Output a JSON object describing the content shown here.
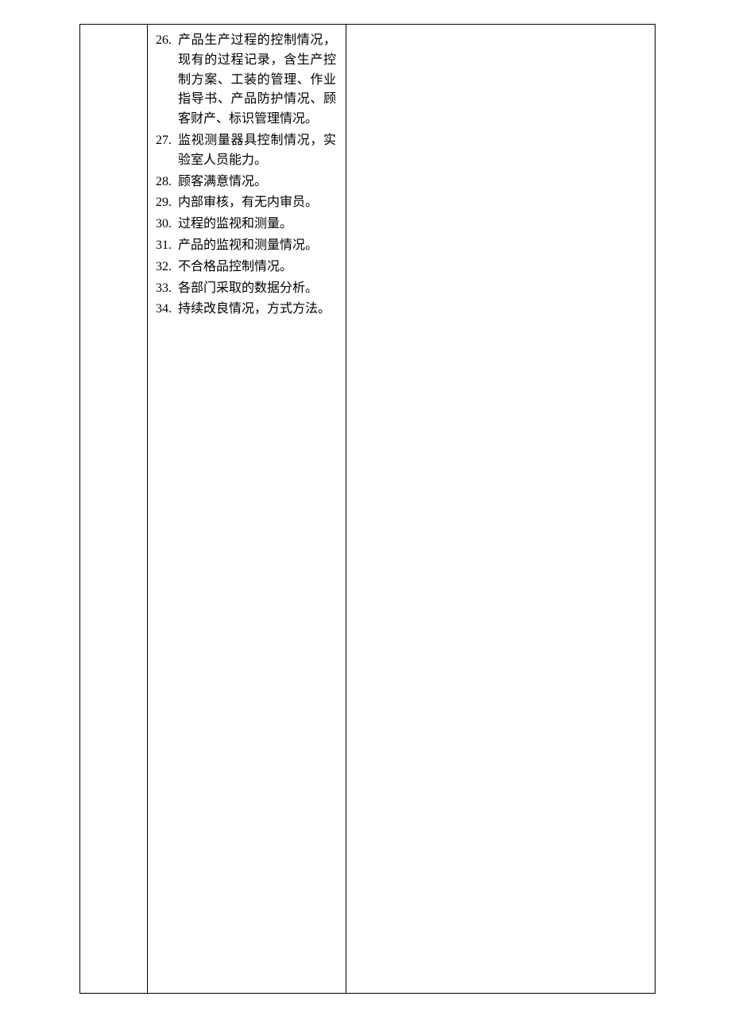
{
  "items": [
    {
      "num": "26.",
      "text": "产品生产过程的控制情况，现有的过程记录，含生产控制方案、工装的管理、作业指导书、产品防护情况、顾客财产、标识管理情况。"
    },
    {
      "num": "27.",
      "text": "监视测量器具控制情况，实验室人员能力。"
    },
    {
      "num": "28.",
      "text": "顾客满意情况。"
    },
    {
      "num": "29.",
      "text": "内部审核，有无内审员。"
    },
    {
      "num": "30.",
      "text": "过程的监视和测量。"
    },
    {
      "num": "31.",
      "text": "产品的监视和测量情况。"
    },
    {
      "num": "32.",
      "text": "不合格品控制情况。"
    },
    {
      "num": "33.",
      "text": "各部门采取的数据分析。"
    },
    {
      "num": "34.",
      "text": "持续改良情况，方式方法。"
    }
  ]
}
